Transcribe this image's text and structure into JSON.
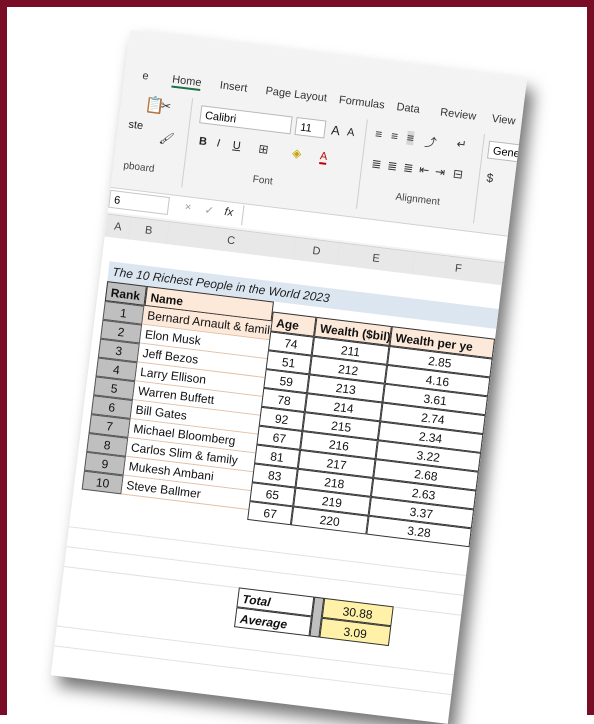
{
  "ribbon": {
    "tabs": [
      "e",
      "Home",
      "Insert",
      "Page Layout",
      "Formulas",
      "Data",
      "Review",
      "View"
    ],
    "paste_label": "ste",
    "clipboard_label": "pboard",
    "font_name": "Calibri",
    "font_size": "11",
    "font_group_label": "Font",
    "alignment_group_label": "Alignment",
    "number_format": "Gene",
    "bold": "B",
    "italic": "I",
    "underline": "U",
    "grow_font": "A",
    "shrink_font": "A",
    "font_color": "A"
  },
  "formula_bar": {
    "name_box": "6",
    "fx": "fx",
    "cancel": "×",
    "enter": "✓"
  },
  "columns": [
    "A",
    "B",
    "C",
    "D",
    "E",
    "F"
  ],
  "table": {
    "title": "The 10 Richest People in the World 2023",
    "headers": {
      "rank": "Rank",
      "name": "Name",
      "age": "Age",
      "wealth": "Wealth ($bil)",
      "wealth_per_year": "Wealth per ye"
    },
    "ranks": [
      "1",
      "2",
      "3",
      "4",
      "5",
      "6",
      "7",
      "8",
      "9",
      "10"
    ],
    "names": [
      "Bernard Arnault & family",
      "Elon Musk",
      "Jeff Bezos",
      "Larry Ellison",
      "Warren Buffett",
      "Bill Gates",
      "Michael Bloomberg",
      "Carlos Slim & family",
      "Mukesh Ambani",
      "Steve Ballmer"
    ],
    "ages": [
      "74",
      "51",
      "59",
      "78",
      "92",
      "67",
      "81",
      "83",
      "65",
      "67"
    ],
    "wealth": [
      "211",
      "212",
      "213",
      "214",
      "215",
      "216",
      "217",
      "218",
      "219",
      "220"
    ],
    "wealth_per_year": [
      "2.85",
      "4.16",
      "3.61",
      "2.74",
      "2.34",
      "3.22",
      "2.68",
      "2.63",
      "3.37",
      "3.28"
    ],
    "total_label": "Total",
    "average_label": "Average",
    "total_value": "30.88",
    "average_value": "3.09"
  },
  "colors": {
    "frame": "#7a0d26",
    "title_fill": "#dce6f1",
    "name_fill": "#fde9d9",
    "rank_fill": "#bfbfbf",
    "summary_fill": "#fff2a8"
  }
}
